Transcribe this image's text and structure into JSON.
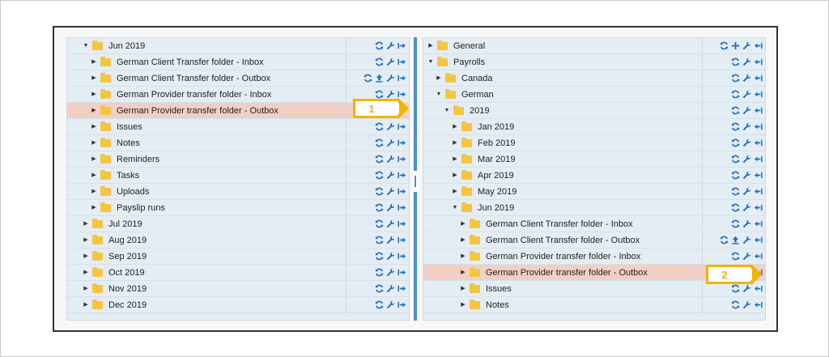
{
  "left_pane": {
    "rows": [
      {
        "label": "Jun 2019",
        "indent": 1,
        "caret": "down",
        "icons": [
          "refresh-icon",
          "wrench-icon",
          "move-right-icon"
        ],
        "highlighted": false
      },
      {
        "label": "German Client Transfer folder - Inbox",
        "indent": 2,
        "caret": "right",
        "icons": [
          "refresh-icon",
          "wrench-icon",
          "move-right-icon"
        ],
        "highlighted": false
      },
      {
        "label": "German Client Transfer folder - Outbox",
        "indent": 2,
        "caret": "right",
        "icons": [
          "refresh-icon",
          "upload-icon",
          "wrench-icon",
          "move-right-icon"
        ],
        "highlighted": false
      },
      {
        "label": "German Provider transfer folder - Inbox",
        "indent": 2,
        "caret": "right",
        "icons": [
          "refresh-icon",
          "wrench-icon",
          "move-right-icon"
        ],
        "highlighted": false
      },
      {
        "label": "German Provider transfer folder - Outbox",
        "indent": 2,
        "caret": "right",
        "icons": [
          "move-right-icon"
        ],
        "highlighted": true
      },
      {
        "label": "Issues",
        "indent": 2,
        "caret": "right",
        "icons": [
          "refresh-icon",
          "wrench-icon",
          "move-right-icon"
        ],
        "highlighted": false
      },
      {
        "label": "Notes",
        "indent": 2,
        "caret": "right",
        "icons": [
          "refresh-icon",
          "wrench-icon",
          "move-right-icon"
        ],
        "highlighted": false
      },
      {
        "label": "Reminders",
        "indent": 2,
        "caret": "right",
        "icons": [
          "refresh-icon",
          "wrench-icon",
          "move-right-icon"
        ],
        "highlighted": false
      },
      {
        "label": "Tasks",
        "indent": 2,
        "caret": "right",
        "icons": [
          "refresh-icon",
          "wrench-icon",
          "move-right-icon"
        ],
        "highlighted": false
      },
      {
        "label": "Uploads",
        "indent": 2,
        "caret": "right",
        "icons": [
          "refresh-icon",
          "wrench-icon",
          "move-right-icon"
        ],
        "highlighted": false
      },
      {
        "label": "Payslip runs",
        "indent": 2,
        "caret": "right",
        "icons": [
          "refresh-icon",
          "wrench-icon",
          "move-right-icon"
        ],
        "highlighted": false
      },
      {
        "label": "Jul 2019",
        "indent": 1,
        "caret": "right",
        "icons": [
          "refresh-icon",
          "wrench-icon",
          "move-right-icon"
        ],
        "highlighted": false
      },
      {
        "label": "Aug 2019",
        "indent": 1,
        "caret": "right",
        "icons": [
          "refresh-icon",
          "wrench-icon",
          "move-right-icon"
        ],
        "highlighted": false
      },
      {
        "label": "Sep 2019",
        "indent": 1,
        "caret": "right",
        "icons": [
          "refresh-icon",
          "wrench-icon",
          "move-right-icon"
        ],
        "highlighted": false
      },
      {
        "label": "Oct 2019",
        "indent": 1,
        "caret": "right",
        "icons": [
          "refresh-icon",
          "wrench-icon",
          "move-right-icon"
        ],
        "highlighted": false
      },
      {
        "label": "Nov 2019",
        "indent": 1,
        "caret": "right",
        "icons": [
          "refresh-icon",
          "wrench-icon",
          "move-right-icon"
        ],
        "highlighted": false
      },
      {
        "label": "Dec 2019",
        "indent": 1,
        "caret": "right",
        "icons": [
          "refresh-icon",
          "wrench-icon",
          "move-right-icon"
        ],
        "highlighted": false
      }
    ]
  },
  "right_pane": {
    "rows": [
      {
        "label": "General",
        "indent": 0,
        "caret": "right",
        "icons": [
          "refresh-icon",
          "add-icon",
          "wrench-icon",
          "move-left-icon"
        ],
        "highlighted": false
      },
      {
        "label": "Payrolls",
        "indent": 0,
        "caret": "down",
        "icons": [
          "refresh-icon",
          "wrench-icon",
          "move-left-icon"
        ],
        "highlighted": false
      },
      {
        "label": "Canada",
        "indent": 1,
        "caret": "right",
        "icons": [
          "refresh-icon",
          "wrench-icon",
          "move-left-icon"
        ],
        "highlighted": false
      },
      {
        "label": "German",
        "indent": 1,
        "caret": "down",
        "icons": [
          "refresh-icon",
          "wrench-icon",
          "move-left-icon"
        ],
        "highlighted": false
      },
      {
        "label": "2019",
        "indent": 2,
        "caret": "down",
        "icons": [
          "refresh-icon",
          "wrench-icon",
          "move-left-icon"
        ],
        "highlighted": false
      },
      {
        "label": "Jan 2019",
        "indent": 3,
        "caret": "right",
        "icons": [
          "refresh-icon",
          "wrench-icon",
          "move-left-icon"
        ],
        "highlighted": false
      },
      {
        "label": "Feb 2019",
        "indent": 3,
        "caret": "right",
        "icons": [
          "refresh-icon",
          "wrench-icon",
          "move-left-icon"
        ],
        "highlighted": false
      },
      {
        "label": "Mar 2019",
        "indent": 3,
        "caret": "right",
        "icons": [
          "refresh-icon",
          "wrench-icon",
          "move-left-icon"
        ],
        "highlighted": false
      },
      {
        "label": "Apr 2019",
        "indent": 3,
        "caret": "right",
        "icons": [
          "refresh-icon",
          "wrench-icon",
          "move-left-icon"
        ],
        "highlighted": false
      },
      {
        "label": "May 2019",
        "indent": 3,
        "caret": "right",
        "icons": [
          "refresh-icon",
          "wrench-icon",
          "move-left-icon"
        ],
        "highlighted": false
      },
      {
        "label": "Jun 2019",
        "indent": 3,
        "caret": "down",
        "icons": [
          "refresh-icon",
          "wrench-icon",
          "move-left-icon"
        ],
        "highlighted": false
      },
      {
        "label": "German Client Transfer folder - Inbox",
        "indent": 4,
        "caret": "right",
        "icons": [
          "refresh-icon",
          "wrench-icon",
          "move-left-icon"
        ],
        "highlighted": false
      },
      {
        "label": "German Client Transfer folder - Outbox",
        "indent": 4,
        "caret": "right",
        "icons": [
          "refresh-icon",
          "upload-icon",
          "wrench-icon",
          "move-left-icon"
        ],
        "highlighted": false
      },
      {
        "label": "German Provider transfer folder - Inbox",
        "indent": 4,
        "caret": "right",
        "icons": [
          "refresh-icon",
          "wrench-icon",
          "move-left-icon"
        ],
        "highlighted": false
      },
      {
        "label": "German Provider transfer folder - Outbox",
        "indent": 4,
        "caret": "right",
        "icons": [
          "wrench-icon",
          "move-left-icon"
        ],
        "highlighted": true
      },
      {
        "label": "Issues",
        "indent": 4,
        "caret": "right",
        "icons": [
          "refresh-icon",
          "wrench-icon",
          "move-left-icon"
        ],
        "highlighted": false
      },
      {
        "label": "Notes",
        "indent": 4,
        "caret": "right",
        "icons": [
          "refresh-icon",
          "wrench-icon",
          "move-left-icon"
        ],
        "highlighted": false
      }
    ]
  },
  "callouts": [
    {
      "label": "1"
    },
    {
      "label": "2"
    }
  ],
  "colors": {
    "highlight": "#f2cfc5",
    "accent": "#f2b400",
    "icon": "#1f6fbf",
    "folder": "#f5c542",
    "splitter": "#4a90c8"
  }
}
